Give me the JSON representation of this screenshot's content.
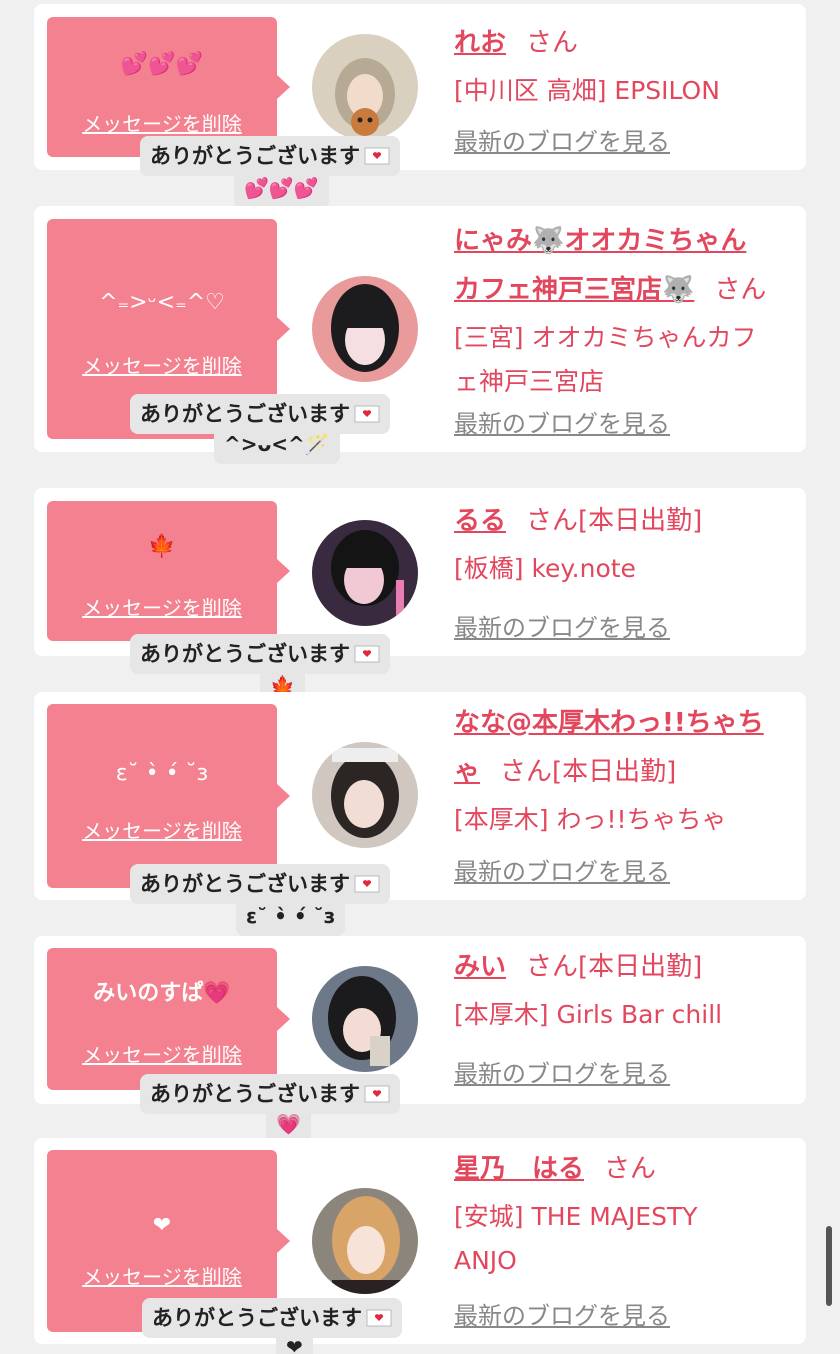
{
  "colors": {
    "bubble": "#f4818f",
    "name": "#e2475e",
    "blog": "#888888",
    "bg": "#f0f0f0"
  },
  "delete_label": "メッセージを削除",
  "thanks_label": "ありがとうございます",
  "san_label": "さん",
  "blog_label": "最新のブログを見る",
  "cards": [
    {
      "message": "💕💕💕",
      "name_lines": [
        "れお"
      ],
      "work": "",
      "shop": [
        "[中川区 高畑] EPSILON"
      ],
      "reply": "💕💕💕",
      "avatar_icon": "girl-avatar"
    },
    {
      "message": "^₌>ᵕ<₌^♡",
      "name_lines": [
        "にゃみ🐺オオカミちゃん",
        "カフェ神戸三宮店🐺"
      ],
      "work": "",
      "shop": [
        "[三宮] オオカミちゃんカフ",
        "ェ神戸三宮店"
      ],
      "reply": "^>ᴗ<^🪄",
      "avatar_icon": "girl-avatar"
    },
    {
      "message": "🍁",
      "name_lines": [
        "るる"
      ],
      "work": "[本日出勤]",
      "shop": [
        "[板橋] key.note"
      ],
      "reply": "🍁",
      "avatar_icon": "girl-avatar"
    },
    {
      "message": "ε˘ •̀ •́ ˘з",
      "name_lines": [
        "なな@本厚木わっ!!ちゃち",
        "ゃ"
      ],
      "work": "[本日出勤]",
      "shop": [
        "[本厚木] わっ!!ちゃちゃ"
      ],
      "reply": "ε˘ •̀ •́ ˘з",
      "avatar_icon": "girl-avatar"
    },
    {
      "message": "みいのすぱ💗",
      "name_lines": [
        "みい"
      ],
      "work": "[本日出勤]",
      "shop": [
        "[本厚木] Girls Bar chill"
      ],
      "reply": "💗",
      "avatar_icon": "girl-avatar"
    },
    {
      "message": "❤",
      "name_lines": [
        "星乃　はる"
      ],
      "work": "",
      "shop": [
        "[安城] THE MAJESTY",
        "ANJO"
      ],
      "reply": "❤",
      "avatar_icon": "girl-avatar"
    }
  ]
}
